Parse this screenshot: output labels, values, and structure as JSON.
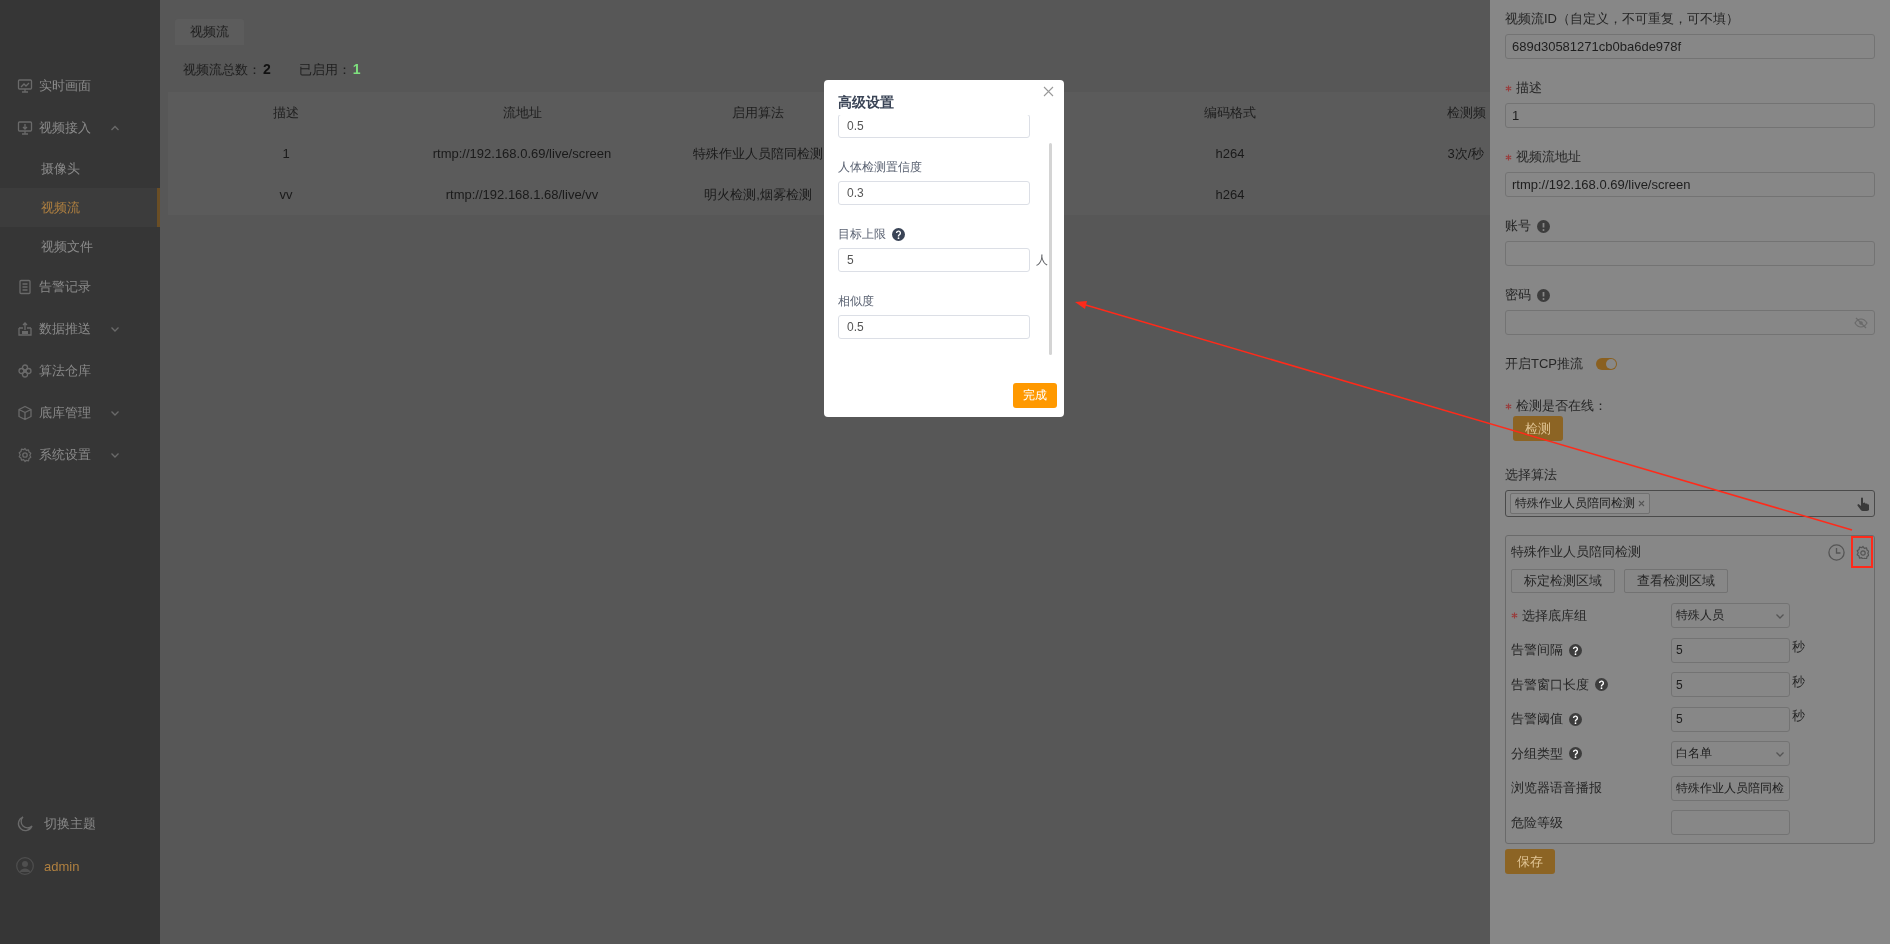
{
  "sidebar": {
    "items": [
      {
        "label": "实时画面",
        "selected": false
      },
      {
        "label": "视频接入",
        "selected": false,
        "expanded": true,
        "children": [
          {
            "label": "摄像头",
            "selected": false
          },
          {
            "label": "视频流",
            "selected": true
          },
          {
            "label": "视频文件",
            "selected": false
          }
        ]
      },
      {
        "label": "告警记录",
        "selected": false
      },
      {
        "label": "数据推送",
        "selected": false,
        "expanded": false
      },
      {
        "label": "算法仓库",
        "selected": false
      },
      {
        "label": "底库管理",
        "selected": false,
        "expanded": false
      },
      {
        "label": "系统设置",
        "selected": false,
        "expanded": false
      }
    ],
    "footer": {
      "theme_toggle": "切换主题",
      "user": "admin"
    }
  },
  "main": {
    "breadcrumb_tab": "视频流",
    "stats": [
      {
        "label": "视频流总数：",
        "value": "2",
        "color": "#111111"
      },
      {
        "label": "已启用：",
        "value": "1",
        "color": "#7ee07e"
      }
    ],
    "table": {
      "columns": [
        "描述",
        "流地址",
        "启用算法",
        "编码格式",
        "检测频"
      ],
      "rows": [
        [
          "1",
          "rtmp://192.168.0.69/live/screen",
          "特殊作业人员陪同检测",
          "h264",
          "3次/秒"
        ],
        [
          "vv",
          "rtmp://192.168.1.68/live/vv",
          "明火检测,烟雾检测",
          "h264"
        ]
      ]
    }
  },
  "drawer": {
    "fields": [
      {
        "kind": "input",
        "label": "视频流ID（自定义，不可重复，可不填）",
        "value": "689d30581271cb0ba6de978f"
      },
      {
        "kind": "input",
        "label": "描述",
        "required": true,
        "value": "1"
      },
      {
        "kind": "input",
        "label": "视频流地址",
        "required": true,
        "value": "rtmp://192.168.0.69/live/screen"
      },
      {
        "kind": "input",
        "label": "账号",
        "info": true
      },
      {
        "kind": "password",
        "label": "密码",
        "info": true
      },
      {
        "kind": "switch",
        "label": "开启TCP推流",
        "on": true
      },
      {
        "kind": "button",
        "label": "检测是否在线：",
        "required": true,
        "button": "检测"
      },
      {
        "kind": "multiselect",
        "label": "选择算法",
        "tags": [
          "特殊作业人员陪同检测"
        ]
      }
    ],
    "algorithm_card": {
      "title": "特殊作业人员陪同检测",
      "buttons": [
        "标定检测区域",
        "查看检测区域"
      ],
      "rows": [
        {
          "kind": "select",
          "label": "选择底库组",
          "required": true,
          "value": "特殊人员"
        },
        {
          "kind": "input",
          "label": "告警间隔",
          "help": true,
          "value": "5",
          "unit": "秒"
        },
        {
          "kind": "input",
          "label": "告警窗口长度",
          "help": true,
          "value": "5",
          "unit": "秒"
        },
        {
          "kind": "input",
          "label": "告警阈值",
          "help": true,
          "value": "5",
          "unit": "秒"
        },
        {
          "kind": "select",
          "label": "分组类型",
          "help": true,
          "value": "白名单"
        },
        {
          "kind": "input",
          "label": "浏览器语音播报",
          "value": "特殊作业人员陪同检"
        },
        {
          "kind": "input",
          "label": "危险等级"
        }
      ]
    },
    "save_button": "保存"
  },
  "modal": {
    "title": "高级设置",
    "fields": [
      {
        "value": "0.5"
      },
      {
        "label": "人体检测置信度",
        "value": "0.3"
      },
      {
        "label": "目标上限",
        "help": true,
        "value": "5",
        "unit": "人"
      },
      {
        "label": "相似度",
        "value": "0.5"
      }
    ],
    "confirm": "完成"
  },
  "annotations": {
    "arrow": true,
    "highlight_box": true
  }
}
